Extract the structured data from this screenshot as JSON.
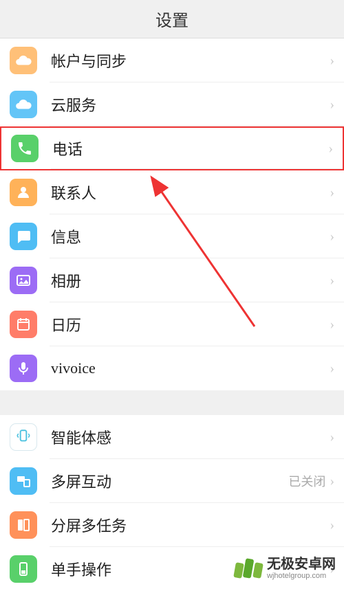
{
  "header": {
    "title": "设置"
  },
  "groups": [
    {
      "items": [
        {
          "id": "account-sync",
          "label": "帐户与同步",
          "icon": "cloud-sync",
          "bg": "#ffc078",
          "fg": "#ffffff"
        },
        {
          "id": "cloud-service",
          "label": "云服务",
          "icon": "cloud",
          "bg": "#63c5f7",
          "fg": "#ffffff"
        },
        {
          "id": "phone",
          "label": "电话",
          "icon": "phone",
          "bg": "#59d06a",
          "fg": "#ffffff",
          "highlight": true
        },
        {
          "id": "contacts",
          "label": "联系人",
          "icon": "person",
          "bg": "#ffb259",
          "fg": "#ffffff"
        },
        {
          "id": "messages",
          "label": "信息",
          "icon": "message",
          "bg": "#4fbdf4",
          "fg": "#ffffff"
        },
        {
          "id": "photos",
          "label": "相册",
          "icon": "photo",
          "bg": "#9c6cf5",
          "fg": "#ffffff"
        },
        {
          "id": "calendar",
          "label": "日历",
          "icon": "calendar",
          "bg": "#ff7d69",
          "fg": "#ffffff"
        },
        {
          "id": "vivoice",
          "label": "vivoice",
          "icon": "mic",
          "bg": "#9c6cf5",
          "fg": "#ffffff"
        }
      ]
    },
    {
      "items": [
        {
          "id": "smart-motion",
          "label": "智能体感",
          "icon": "motion",
          "bg": "#ffffff",
          "fg": "#4fc3e0",
          "border": true
        },
        {
          "id": "multi-screen",
          "label": "多屏互动",
          "icon": "multiscreen",
          "bg": "#4fbdf4",
          "fg": "#ffffff",
          "value": "已关闭"
        },
        {
          "id": "split-screen",
          "label": "分屏多任务",
          "icon": "split",
          "bg": "#ff915a",
          "fg": "#ffffff"
        },
        {
          "id": "one-hand",
          "label": "单手操作",
          "icon": "onehand",
          "bg": "#59d06a",
          "fg": "#ffffff"
        }
      ]
    }
  ],
  "watermark": {
    "title": "无极安卓网",
    "sub": "wjhotelgroup.com"
  }
}
